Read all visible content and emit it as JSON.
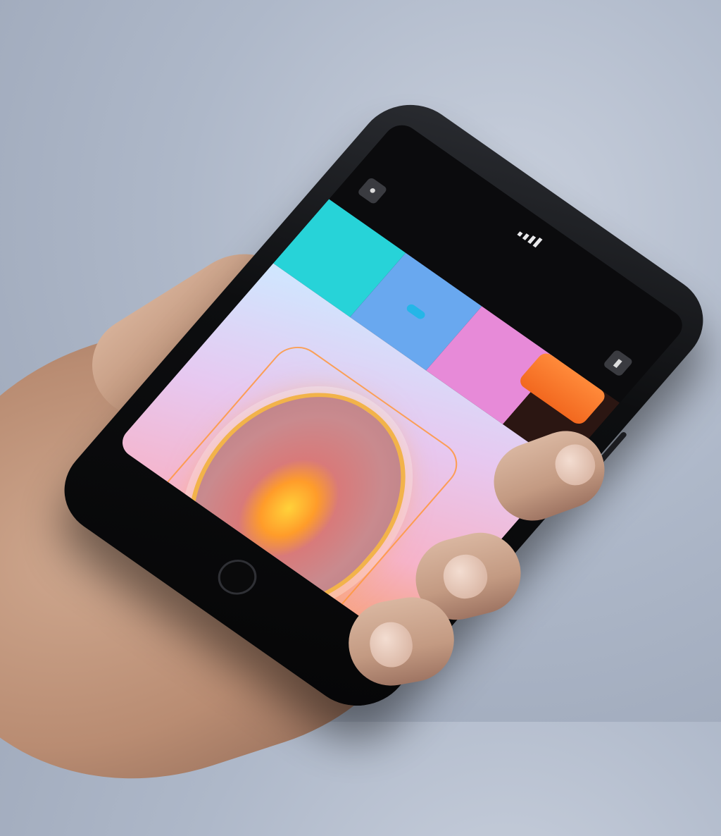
{
  "scene": {
    "description_kind": "photo of a hand holding a smartphone displaying a colorful medical-imaging style app",
    "colors": {
      "background": "#aeb8c9",
      "phone_body": "#0d0e10",
      "tab_cyan": "#27d3d8",
      "tab_blue": "#69a8ef",
      "tab_pink": "#e78ad8",
      "accent_orange": "#f2681f",
      "panel_gradient_start": "#cfe7ff",
      "panel_gradient_end": "#f7a077",
      "organ_glow": "#ffd23a"
    }
  },
  "phone": {
    "status": {
      "left": "",
      "right": ""
    },
    "header": {
      "title": ""
    },
    "tabs": [
      {
        "label": ""
      },
      {
        "label": ""
      },
      {
        "label": ""
      },
      {
        "label": ""
      }
    ],
    "icons": [
      "profile-icon",
      "signal-icon",
      "battery-icon",
      "home-button"
    ]
  }
}
